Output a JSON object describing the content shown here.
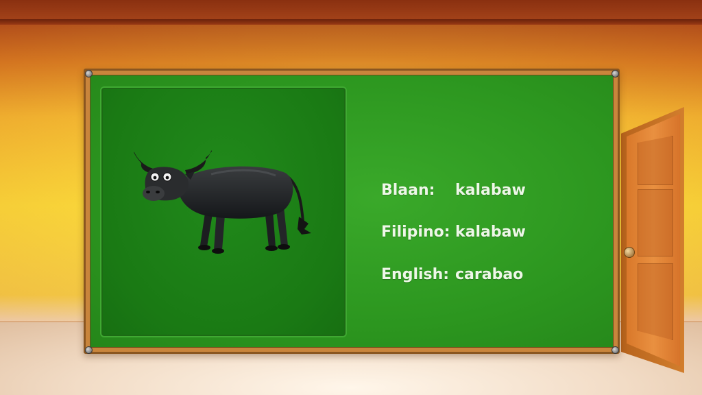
{
  "vocab": {
    "rows": [
      {
        "lang": "Blaan:",
        "word": "kalabaw"
      },
      {
        "lang": "Filipino:",
        "word": "kalabaw"
      },
      {
        "lang": "English:",
        "word": "carabao"
      }
    ]
  },
  "illustration": {
    "icon": "carabao-icon"
  },
  "colors": {
    "board_green": "#2c961f",
    "panel_green": "#1a7a14",
    "board_frame": "#c9853c",
    "text": "#eef7e8",
    "door": "#e08a3a"
  }
}
